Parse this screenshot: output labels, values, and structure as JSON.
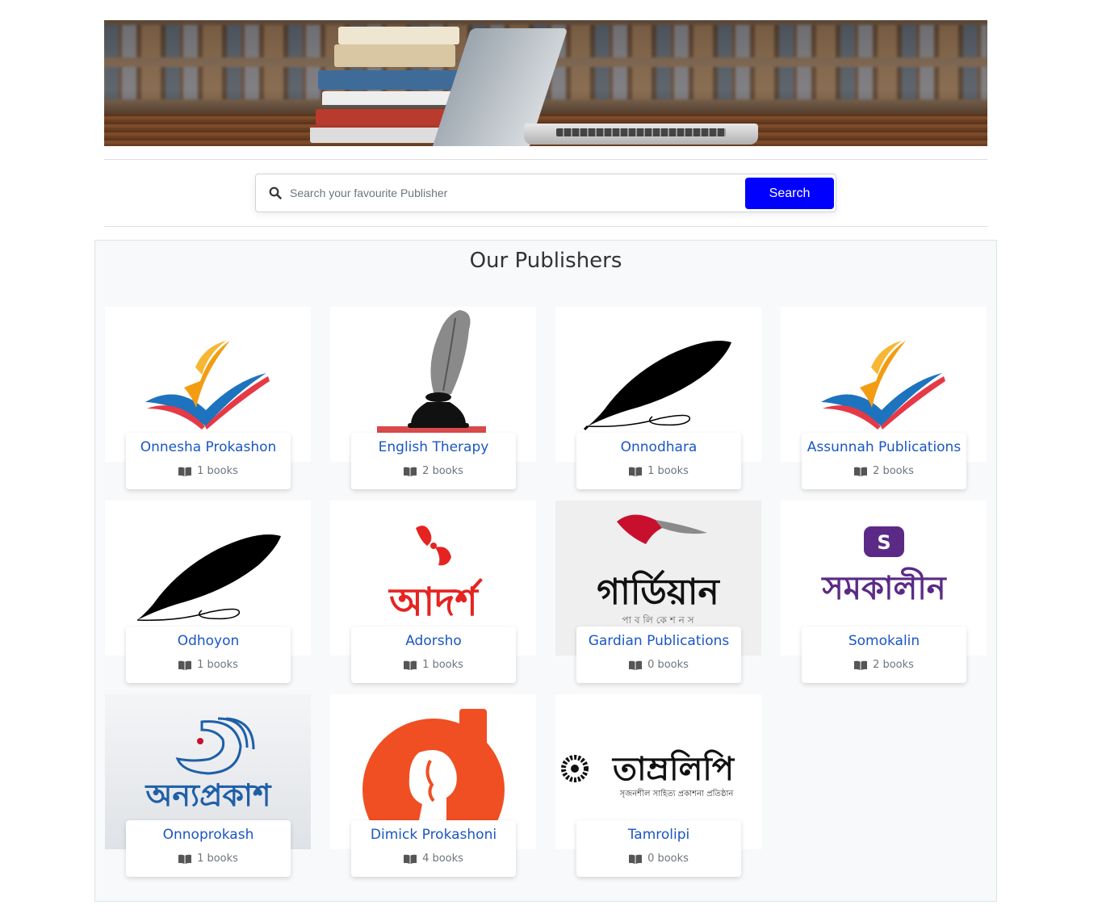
{
  "search": {
    "placeholder": "Search your favourite Publisher",
    "button_label": "Search"
  },
  "section": {
    "title": "Our Publishers"
  },
  "publishers": [
    {
      "name": "Onnesha Prokashon",
      "count": "1 books",
      "logo": "check-book-logo"
    },
    {
      "name": "English Therapy",
      "count": "2 books",
      "logo": "quill-inkpot-logo"
    },
    {
      "name": "Onnodhara",
      "count": "1 books",
      "logo": "feather-quill-logo"
    },
    {
      "name": "Assunnah Publications",
      "count": "2 books",
      "logo": "check-book-logo"
    },
    {
      "name": "Odhoyon",
      "count": "1 books",
      "logo": "feather-quill-logo"
    },
    {
      "name": "Adorsho",
      "count": "1 books",
      "logo": "adorsho-bangla-logo",
      "logo_text": "আদর্শ"
    },
    {
      "name": "Gardian Publications",
      "count": "0 books",
      "logo": "guardian-bangla-logo",
      "logo_text": "গার্ডিয়ান",
      "logo_subtext": "পা ব লি কে শ ন স"
    },
    {
      "name": "Somokalin",
      "count": "2 books",
      "logo": "somokalin-bangla-logo",
      "logo_text": "সমকালীন"
    },
    {
      "name": "Onnoprokash",
      "count": "1 books",
      "logo": "onnoprokash-bangla-logo",
      "logo_text": "অন্যপ্রকাশ"
    },
    {
      "name": "Dimick Prokashoni",
      "count": "4 books",
      "logo": "dimick-d-logo"
    },
    {
      "name": "Tamrolipi",
      "count": "0 books",
      "logo": "tamrolipi-bangla-logo",
      "logo_text": "তাম্রলিপি",
      "logo_subtext": "সৃজনশীল সাহিত্য প্রকাশনা প্রতিষ্ঠান"
    }
  ],
  "colors": {
    "search_button": "#0000ff",
    "publisher_link": "#1a56c4",
    "section_bg": "#f8f9fa"
  }
}
